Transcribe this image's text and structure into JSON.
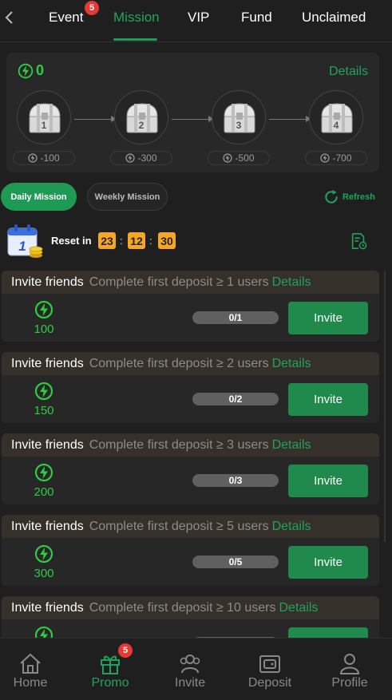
{
  "header": {
    "tabs": [
      {
        "label": "Event",
        "badge": "5",
        "active": false
      },
      {
        "label": "Mission",
        "active": true
      },
      {
        "label": "VIP",
        "active": false
      },
      {
        "label": "Fund",
        "active": false
      },
      {
        "label": "Unclaimed",
        "active": false
      }
    ]
  },
  "chest_panel": {
    "points": "0",
    "details_label": "Details",
    "chests": [
      {
        "number": "1",
        "cost": "-100"
      },
      {
        "number": "2",
        "cost": "-300"
      },
      {
        "number": "3",
        "cost": "-500"
      },
      {
        "number": "4",
        "cost": "-700"
      }
    ]
  },
  "mission_tabs": {
    "daily": "Daily Mission",
    "weekly": "Weekly Mission",
    "refresh": "Refresh"
  },
  "reset": {
    "label": "Reset in",
    "hours": "23",
    "minutes": "12",
    "seconds": "30",
    "separator": ":"
  },
  "missions": [
    {
      "title": "Invite friends",
      "description": "Complete first deposit ≥ 1 users",
      "details": "Details",
      "reward": "100",
      "progress": "0/1",
      "button": "Invite"
    },
    {
      "title": "Invite friends",
      "description": "Complete first deposit ≥ 2 users",
      "details": "Details",
      "reward": "150",
      "progress": "0/2",
      "button": "Invite"
    },
    {
      "title": "Invite friends",
      "description": "Complete first deposit ≥ 3 users",
      "details": "Details",
      "reward": "200",
      "progress": "0/3",
      "button": "Invite"
    },
    {
      "title": "Invite friends",
      "description": "Complete first deposit ≥ 5 users",
      "details": "Details",
      "reward": "300",
      "progress": "0/5",
      "button": "Invite"
    },
    {
      "title": "Invite friends",
      "description": "Complete first deposit ≥ 10 users",
      "details": "Details",
      "reward": "",
      "progress": "",
      "button": ""
    }
  ],
  "bottom_nav": {
    "items": [
      {
        "label": "Home",
        "icon": "home-icon"
      },
      {
        "label": "Promo",
        "icon": "gift-icon",
        "badge": "5",
        "active": true
      },
      {
        "label": "Invite",
        "icon": "users-icon"
      },
      {
        "label": "Deposit",
        "icon": "wallet-icon"
      },
      {
        "label": "Profile",
        "icon": "profile-icon"
      }
    ]
  },
  "colors": {
    "accent_green": "#1f9a55",
    "bright_green": "#2ecc40",
    "badge_red": "#e53935",
    "timer_orange": "#f5a623",
    "background": "#1f1f1f"
  }
}
